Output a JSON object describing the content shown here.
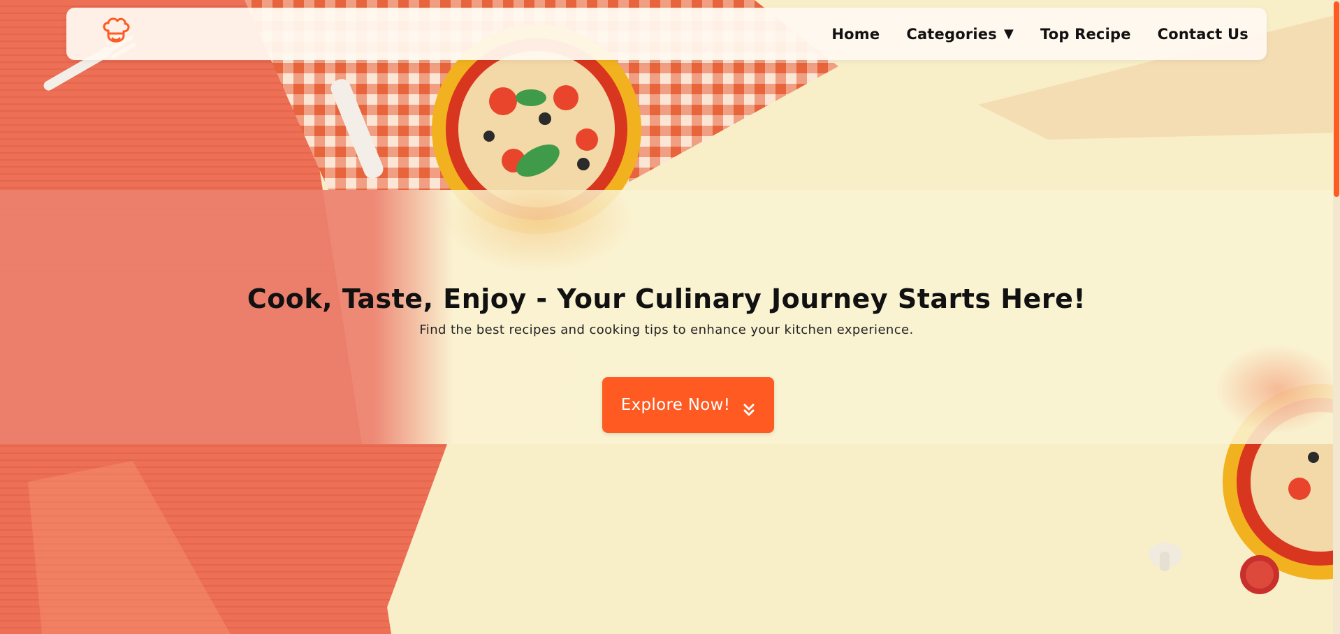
{
  "brand": {
    "logo_icon": "chef-hat-icon",
    "accent_color": "#fe5a22"
  },
  "nav": {
    "items": [
      {
        "label": "Home"
      },
      {
        "label": "Categories",
        "icon": "caret-down-icon",
        "caret": "▼"
      },
      {
        "label": "Top Recipe"
      },
      {
        "label": "Contact Us"
      }
    ]
  },
  "hero": {
    "title": "Cook, Taste, Enjoy - Your Culinary Journey Starts Here!",
    "subtitle": "Find the best recipes and cooking tips to enhance your kitchen experience.",
    "cta_label": "Explore Now!",
    "cta_icon": "double-chevron-down-icon"
  },
  "colors": {
    "table_red": "#ec6f56",
    "cream": "#f8efc8",
    "checker": "#e8643c"
  }
}
